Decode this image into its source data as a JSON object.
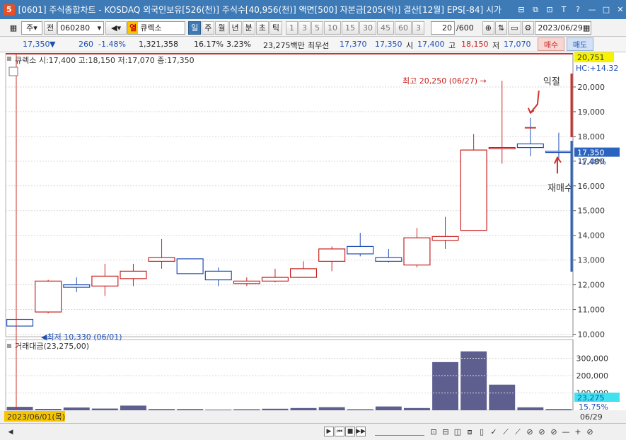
{
  "window": {
    "badge": "5",
    "title": "[0601] 주식종합차트 - KOSDAQ 외국인보유[526(천)] 주식수[40,956(천)] 액면[500] 자본금[205(억)] 결산[12월] EPS[-84] 시가",
    "icons": [
      "restore-icon",
      "window-icon",
      "copy-icon",
      "font-size-icon",
      "help-icon",
      "minimize-icon",
      "maximize-icon",
      "close-icon"
    ],
    "icon_glyphs": [
      "⊟",
      "⧉",
      "⊡",
      "T",
      "?",
      "—",
      "□",
      "✕"
    ]
  },
  "toolbar": {
    "grid_glyph": "▦",
    "market": "주",
    "prev_label": "전",
    "code": "060280",
    "dropdown_arrow": "▾",
    "flag": "열",
    "stock_name": "큐렉소",
    "periods": [
      "일",
      "주",
      "월",
      "년",
      "분",
      "초",
      "틱"
    ],
    "active_period": "일",
    "numbers": [
      "1",
      "3",
      "5",
      "10",
      "15",
      "30",
      "45",
      "60",
      "3"
    ],
    "count": "20",
    "count_total": "/600",
    "date": "2023/06/29",
    "tool_glyphs": [
      "⊕",
      "⇅",
      "▭",
      "⚙"
    ]
  },
  "quote": {
    "price": "17,350",
    "arrow": "▼",
    "change": "260",
    "change_pct": "-1.48%",
    "volume": "1,321,358",
    "turnover": "16.17%",
    "pct2": "3.23%",
    "amount": "23,275백만",
    "best_ask_label": "최우선",
    "best_ask": "17,370",
    "best_bid": "17,350",
    "open_label": "시",
    "open": "17,400",
    "high_label": "고",
    "high": "18,150",
    "low_label": "저",
    "low": "17,070",
    "buy_label": "매수",
    "sell_label": "매도"
  },
  "chart_data": {
    "type": "candlestick",
    "legend": "큐렉소 시:17,400 고:18,150 저:17,070 종:17,350",
    "candles": [
      {
        "o": 10600,
        "h": 10600,
        "l": 10330,
        "c": 10330
      },
      {
        "o": 10900,
        "h": 12200,
        "l": 10850,
        "c": 12150
      },
      {
        "o": 12000,
        "h": 12300,
        "l": 11700,
        "c": 11900
      },
      {
        "o": 11950,
        "h": 12850,
        "l": 11550,
        "c": 12350
      },
      {
        "o": 12250,
        "h": 12850,
        "l": 11950,
        "c": 12550
      },
      {
        "o": 12950,
        "h": 13850,
        "l": 12650,
        "c": 13100
      },
      {
        "o": 13050,
        "h": 13050,
        "l": 12450,
        "c": 12450
      },
      {
        "o": 12550,
        "h": 12700,
        "l": 11950,
        "c": 12200
      },
      {
        "o": 12050,
        "h": 12300,
        "l": 11950,
        "c": 12150
      },
      {
        "o": 12150,
        "h": 12650,
        "l": 12100,
        "c": 12300
      },
      {
        "o": 12300,
        "h": 12950,
        "l": 12300,
        "c": 12650
      },
      {
        "o": 12950,
        "h": 13550,
        "l": 12550,
        "c": 13450
      },
      {
        "o": 13550,
        "h": 14100,
        "l": 13150,
        "c": 13250
      },
      {
        "o": 13100,
        "h": 13450,
        "l": 12900,
        "c": 12950
      },
      {
        "o": 12800,
        "h": 14300,
        "l": 12700,
        "c": 13900
      },
      {
        "o": 13800,
        "h": 14750,
        "l": 13450,
        "c": 13950
      },
      {
        "o": 14200,
        "h": 18100,
        "l": 14200,
        "c": 17450
      },
      {
        "o": 17500,
        "h": 20250,
        "l": 16900,
        "c": 17550
      },
      {
        "o": 17700,
        "h": 18750,
        "l": 17200,
        "c": 17550
      },
      {
        "o": 17400,
        "h": 18150,
        "l": 17070,
        "c": 17350
      }
    ],
    "y_ticks": [
      "10,000",
      "11,000",
      "12,000",
      "13,000",
      "14,000",
      "15,000",
      "16,000",
      "17,000",
      "18,000",
      "19,000",
      "20,000"
    ],
    "y_range": [
      9900,
      21000
    ],
    "top_label": "20,751",
    "top_partial_label": "HC:+14.32",
    "last_label": "17,350",
    "last_pct": "-1.48%",
    "max_annotation": "최고 20,250 (06/27)",
    "min_annotation": "최저 10,330 (06/01)",
    "annotation_profit": "익절",
    "annotation_rebuy": "재매수",
    "volume_legend": "거래대금(23,275,00)",
    "volume_values": [
      20,
      8,
      16,
      10,
      27,
      7,
      7,
      4,
      6,
      9,
      13,
      18,
      6,
      22,
      13,
      278,
      340,
      148,
      17,
      7
    ],
    "volume_range": [
      0,
      400
    ],
    "volume_ticks": [
      "100,000",
      "200,000",
      "300,000"
    ],
    "volume_last_label": "23,275",
    "volume_last_pct": "15.75%",
    "date_left": "2023/06/01(목)",
    "date_right": "06/29",
    "colors": {
      "up": "#c8211f",
      "down": "#1f4fb4",
      "volume": "#5e5f8f",
      "label_bg": "#2a64c0",
      "top_bg": "#f7f300"
    }
  },
  "bottom": {
    "scroll_left": "◀",
    "nav": [
      "▶",
      "⏮",
      "■",
      "▶▶"
    ],
    "icons_glyphs": [
      "⊡",
      "⊟",
      "◫",
      "⧈",
      "▯",
      "✓",
      "⟋",
      "⟋",
      "⊘",
      "⊘",
      "⊘",
      "—",
      "+",
      "⊘"
    ]
  }
}
